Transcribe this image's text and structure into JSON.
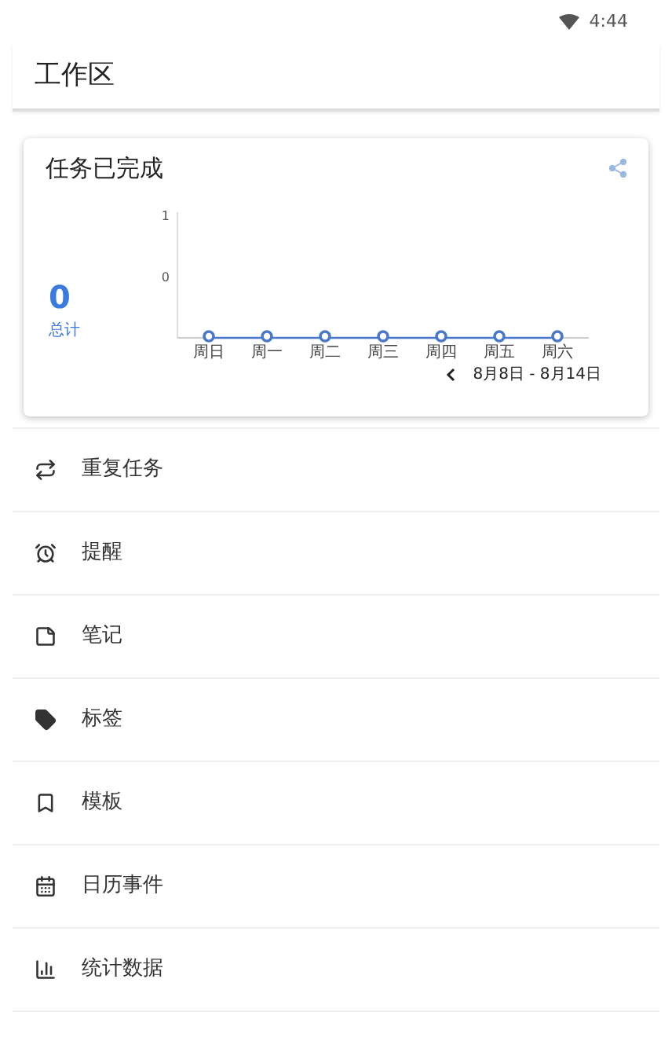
{
  "status_bar": {
    "time": "4:44"
  },
  "header": {
    "title": "工作区"
  },
  "card": {
    "title": "任务已完成",
    "total": "0",
    "total_label": "总计",
    "date_range": "8月8日 - 8月14日",
    "chart_data": {
      "type": "line",
      "categories": [
        "周日",
        "周一",
        "周二",
        "周三",
        "周四",
        "周五",
        "周六"
      ],
      "ylim": [
        0,
        1
      ],
      "yticks": [
        {
          "value": 1,
          "label": "1"
        },
        {
          "value": 0.5,
          "label": "0"
        }
      ],
      "series": [
        {
          "color": "#4a78c8",
          "marker": "circle",
          "values": [
            0,
            0,
            0,
            0,
            0,
            0,
            0
          ]
        }
      ]
    }
  },
  "menu": [
    {
      "kind": "repeat",
      "label": "重复任务"
    },
    {
      "kind": "alarm",
      "label": "提醒"
    },
    {
      "kind": "note",
      "label": "笔记"
    },
    {
      "kind": "tag",
      "label": "标签"
    },
    {
      "kind": "bookmark",
      "label": "模板"
    },
    {
      "kind": "calendar",
      "label": "日历事件"
    },
    {
      "kind": "stats",
      "label": "统计数据"
    }
  ]
}
